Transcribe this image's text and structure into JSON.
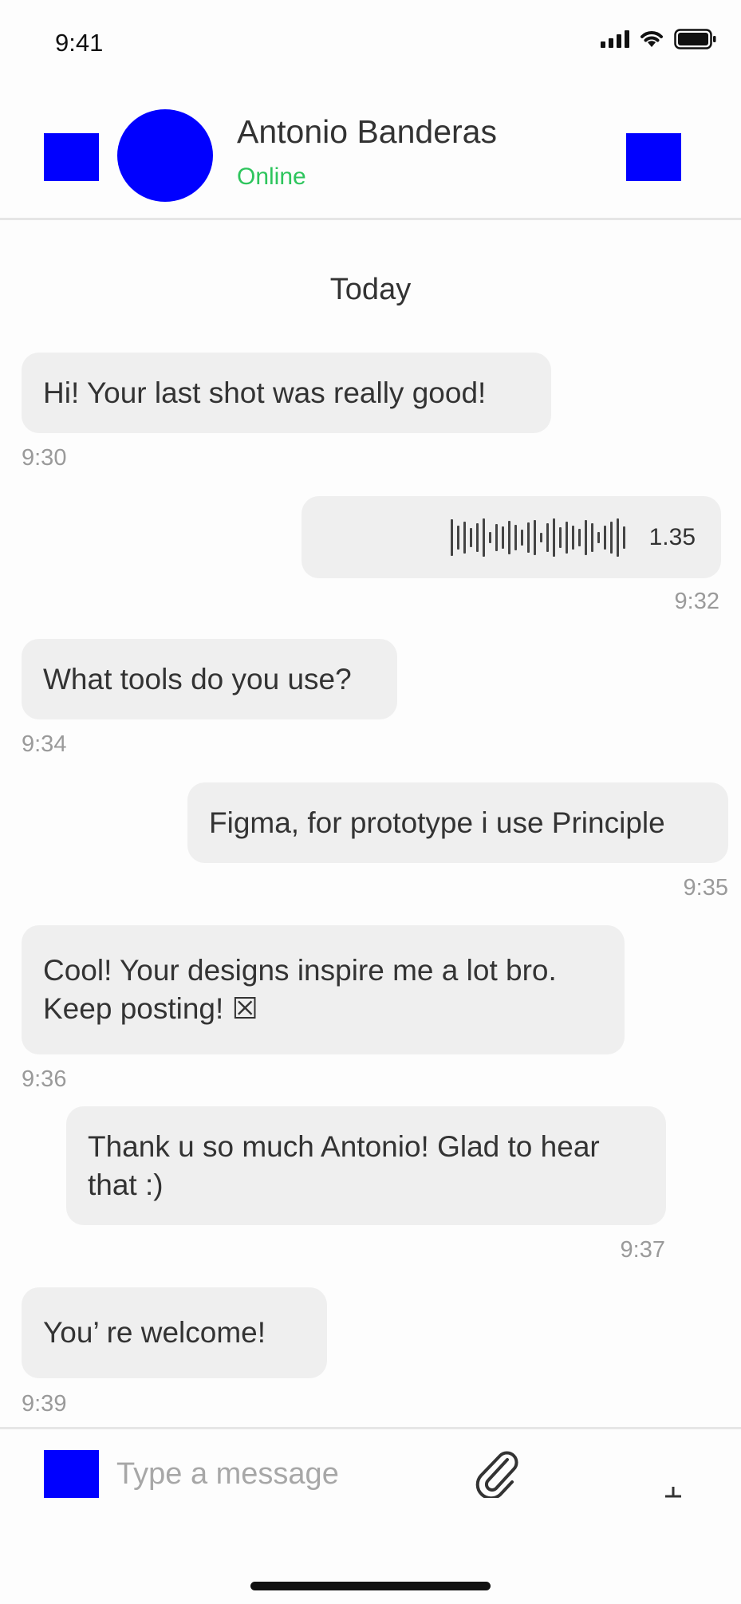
{
  "status_bar": {
    "time": "9:41"
  },
  "header": {
    "contact_name": "Antonio Banderas",
    "contact_status": "Online",
    "status_color": "#2ec55d",
    "avatar_color": "#0000ff"
  },
  "conversation": {
    "day_separator": "Today",
    "messages": [
      {
        "side": "received",
        "text": "Hi! Your last shot was really good!",
        "time": "9:30"
      },
      {
        "side": "sent",
        "type": "voice",
        "duration": "1.35",
        "time": "9:32"
      },
      {
        "side": "received",
        "text": "What tools do you use?",
        "time": "9:34"
      },
      {
        "side": "sent",
        "text": "Figma, for prototype i use Principle",
        "time": "9:35"
      },
      {
        "side": "received",
        "line1": "Cool! Your designs inspire me a lot bro.",
        "line2": "Keep posting! ☒",
        "time": "9:36"
      },
      {
        "side": "sent",
        "line1": "Thank u so much Antonio! Glad to hear",
        "line2": "that :)",
        "time": "9:37"
      },
      {
        "side": "received",
        "text": "You’ re welcome!",
        "time": "9:39"
      }
    ]
  },
  "composer": {
    "placeholder": "Type a message",
    "icons": [
      "emoji-icon",
      "paperclip-icon",
      "send-icon"
    ]
  },
  "colors": {
    "bubble": "#efefef",
    "accent_placeholder": "#0000ff",
    "timestamp": "#9a9a9a"
  }
}
